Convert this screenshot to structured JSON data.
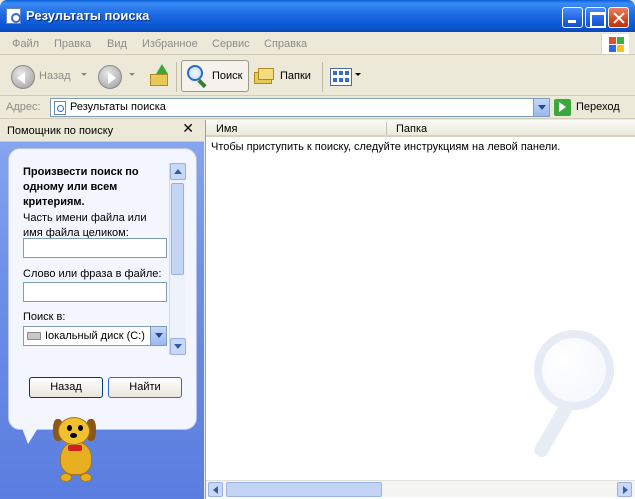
{
  "window": {
    "title": "Результаты поиска"
  },
  "menu": {
    "items": [
      "Файл",
      "Правка",
      "Вид",
      "Избранное",
      "Сервис",
      "Справка"
    ]
  },
  "toolbar": {
    "back_label": "Назад",
    "search_label": "Поиск",
    "folders_label": "Папки"
  },
  "address": {
    "label": "Адрес:",
    "value": "Результаты поиска",
    "go_label": "Переход"
  },
  "search_pane": {
    "header": "Помощник по поиску",
    "close_glyph": "✕",
    "heading": "Произвести поиск по одному или всем критериям.",
    "filename_label": "Часть имени файла или имя файла целиком:",
    "filename_value": "",
    "phrase_label": "Слово или фраза в файле:",
    "phrase_value": "",
    "location_label": "Поиск в:",
    "location_value": "Iокальный диск (C:)",
    "back_button": "Назад",
    "find_button": "Найти"
  },
  "results": {
    "columns": [
      "Имя",
      "Папка"
    ],
    "instructions": "Чтобы приступить к поиску, следуйте инструкциям на левой панели."
  },
  "colors": {
    "titlebar": "#1d6ae6",
    "pane_blue": "#6f90e8",
    "bubble": "#f4f6ff"
  }
}
